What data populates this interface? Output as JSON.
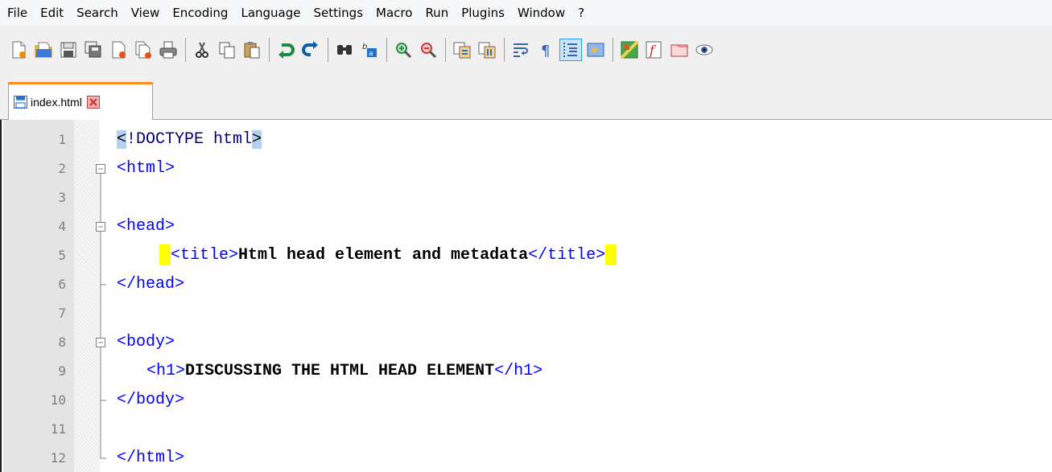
{
  "menu": [
    "File",
    "Edit",
    "Search",
    "View",
    "Encoding",
    "Language",
    "Settings",
    "Macro",
    "Run",
    "Plugins",
    "Window",
    "?"
  ],
  "toolbar": {
    "buttons": [
      {
        "name": "new-file-icon"
      },
      {
        "name": "open-file-icon"
      },
      {
        "name": "save-icon"
      },
      {
        "name": "save-all-icon"
      },
      {
        "name": "close-icon"
      },
      {
        "name": "close-all-icon"
      },
      {
        "name": "print-icon"
      },
      {
        "name": "cut-icon"
      },
      {
        "name": "copy-icon"
      },
      {
        "name": "paste-icon"
      },
      {
        "name": "undo-icon"
      },
      {
        "name": "redo-icon"
      },
      {
        "name": "find-icon"
      },
      {
        "name": "replace-icon"
      },
      {
        "name": "zoom-in-icon"
      },
      {
        "name": "zoom-out-icon"
      },
      {
        "name": "sync-vertical-icon"
      },
      {
        "name": "sync-horizontal-icon"
      },
      {
        "name": "word-wrap-icon"
      },
      {
        "name": "show-all-characters-icon"
      },
      {
        "name": "indent-guide-icon"
      },
      {
        "name": "user-language-icon"
      },
      {
        "name": "document-map-icon"
      },
      {
        "name": "function-list-icon"
      },
      {
        "name": "folder-workspace-icon"
      },
      {
        "name": "monitoring-icon"
      }
    ]
  },
  "tab": {
    "label": "index.html"
  },
  "editor": {
    "lines": [
      {
        "num": "1"
      },
      {
        "num": "2"
      },
      {
        "num": "3"
      },
      {
        "num": "4"
      },
      {
        "num": "5"
      },
      {
        "num": "6"
      },
      {
        "num": "7"
      },
      {
        "num": "8"
      },
      {
        "num": "9"
      },
      {
        "num": "10"
      },
      {
        "num": "11"
      },
      {
        "num": "12"
      }
    ],
    "code": {
      "l1_open": "<",
      "l1_doctype": "!DOCTYPE html",
      "l1_close": ">",
      "l2": "<html>",
      "l4": "<head>",
      "l5_open": "<title>",
      "l5_text": "Html head element and metadata",
      "l5_close": "</title>",
      "l6": "</head>",
      "l8": "<body>",
      "l9_open": "<h1>",
      "l9_text": "DISCUSSING THE HTML HEAD ELEMENT",
      "l9_close": "</h1>",
      "l10": "</body>",
      "l12": "</html>"
    }
  },
  "colors": {
    "tag": "#0000ff",
    "text": "#000000",
    "brace_highlight": "#b3d1ee",
    "whitespace_highlight": "#ffff00",
    "active_tab_accent": "#fa8a1e"
  }
}
